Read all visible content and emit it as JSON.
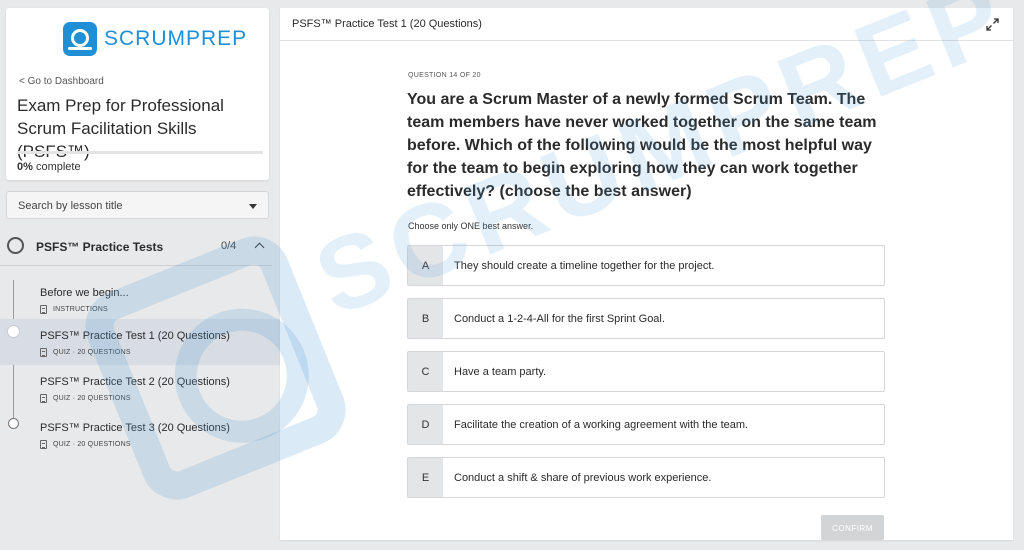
{
  "brand": {
    "name": "SCRUMPREP",
    "accent": "#1f8fd6"
  },
  "sidebar": {
    "back_link": "< Go to Dashboard",
    "course_title": "Exam Prep for Professional Scrum Facilitation Skills (PSFS™)",
    "progress_percent": "0%",
    "progress_label": " complete",
    "progress_value": 0,
    "search_placeholder": "Search by lesson title",
    "section": {
      "title": "PSFS™ Practice Tests",
      "count": "0/4"
    },
    "lessons": [
      {
        "title": "Before we begin...",
        "meta": "INSTRUCTIONS",
        "active": false
      },
      {
        "title": "PSFS™ Practice Test 1 (20 Questions)",
        "meta": "QUIZ · 20 QUESTIONS",
        "active": true
      },
      {
        "title": "PSFS™ Practice Test 2 (20 Questions)",
        "meta": "QUIZ · 20 QUESTIONS",
        "active": false
      },
      {
        "title": "PSFS™ Practice Test 3 (20 Questions)",
        "meta": "QUIZ · 20 QUESTIONS",
        "active": false
      }
    ]
  },
  "main": {
    "title": "PSFS™ Practice Test 1 (20 Questions)",
    "question_counter": "QUESTION 14 OF 20",
    "question_text": "You are a Scrum Master of a newly formed Scrum Team. The team members have never worked together on the same team before. Which of the following would be the most helpful way for the team to begin exploring how they can work together effectively? (choose the best answer)",
    "instruction": "Choose only ONE best answer.",
    "answers": [
      {
        "letter": "A",
        "text": "They should create a timeline together for the project."
      },
      {
        "letter": "B",
        "text": "Conduct a 1-2-4-All for the first Sprint Goal."
      },
      {
        "letter": "C",
        "text": "Have a team party."
      },
      {
        "letter": "D",
        "text": "Facilitate the creation of a working agreement with the team."
      },
      {
        "letter": "E",
        "text": "Conduct a shift & share of previous work experience."
      }
    ],
    "confirm_label": "CONFIRM"
  },
  "watermark": {
    "text": "SCRUMPREP"
  }
}
